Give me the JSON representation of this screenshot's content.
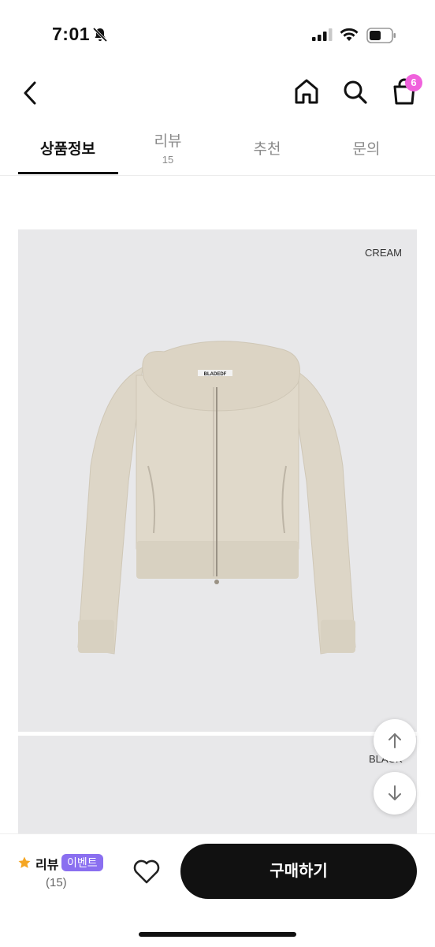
{
  "status_bar": {
    "time": "7:01"
  },
  "nav": {
    "cart_count": "6"
  },
  "tabs": [
    {
      "label": "상품정보"
    },
    {
      "label": "리뷰",
      "count": "15"
    },
    {
      "label": "추천"
    },
    {
      "label": "문의"
    }
  ],
  "product_images": [
    {
      "caption": "CREAM",
      "item": "cream zip-up hoodie",
      "logo_text": "BLADEDF"
    },
    {
      "caption": "BLACK"
    }
  ],
  "review_summary": {
    "label": "리뷰",
    "event_badge": "이벤트",
    "count": "(15)"
  },
  "buy_button": {
    "label": "구매하기"
  },
  "colors": {
    "badge": "#f062dc",
    "event": "#8a6ff0",
    "star": "#f5a623",
    "button": "#111111"
  }
}
